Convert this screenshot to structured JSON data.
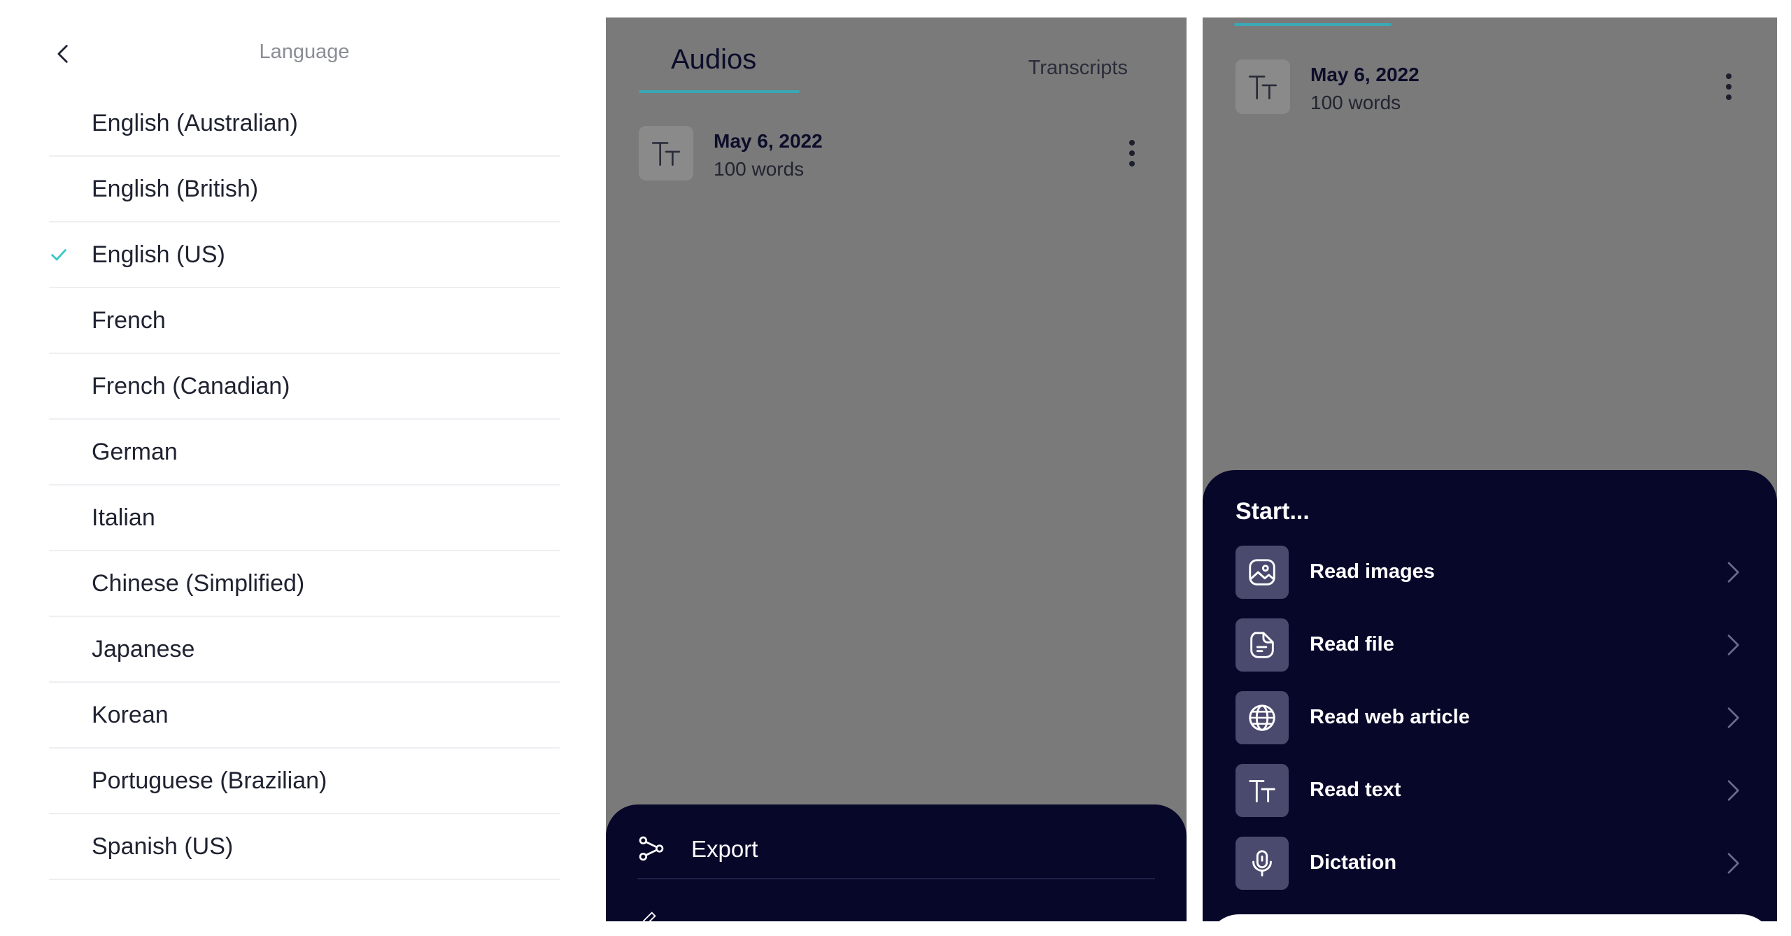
{
  "language_screen": {
    "title": "Language",
    "selected": "English (US)",
    "accent_color": "#3cc6c9",
    "items": [
      {
        "label": "English (Australian)"
      },
      {
        "label": "English (British)"
      },
      {
        "label": "English (US)"
      },
      {
        "label": "French"
      },
      {
        "label": "French (Canadian)"
      },
      {
        "label": "German"
      },
      {
        "label": "Italian"
      },
      {
        "label": "Chinese (Simplified)"
      },
      {
        "label": "Japanese"
      },
      {
        "label": "Korean"
      },
      {
        "label": "Portuguese (Brazilian)"
      },
      {
        "label": "Spanish (US)"
      }
    ]
  },
  "audios_screen": {
    "tabs": {
      "audios": "Audios",
      "transcripts": "Transcripts"
    },
    "document": {
      "date": "May 6, 2022",
      "words": "100 words"
    },
    "sheet": {
      "export_label": "Export"
    }
  },
  "start_screen": {
    "document": {
      "date": "May 6, 2022",
      "words": "100 words"
    },
    "title": "Start...",
    "actions": [
      {
        "label": "Read images",
        "icon": "image-icon"
      },
      {
        "label": "Read file",
        "icon": "file-icon"
      },
      {
        "label": "Read web article",
        "icon": "globe-icon"
      },
      {
        "label": "Read text",
        "icon": "text-icon"
      },
      {
        "label": "Dictation",
        "icon": "microphone-icon"
      }
    ]
  },
  "colors": {
    "sheet_background": "#07072a",
    "overlay_gray": "#7a7a7a",
    "tab_accent": "#3aa8b5"
  }
}
